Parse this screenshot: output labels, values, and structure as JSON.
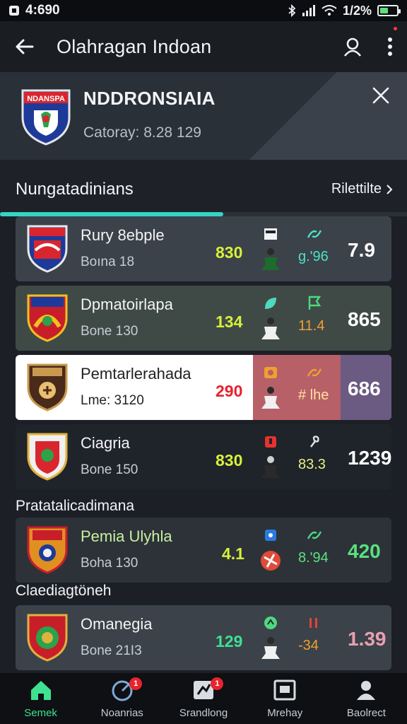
{
  "status_bar": {
    "time": "4:690",
    "battery": "1/2%",
    "battery_level": 0.5
  },
  "header": {
    "title": "Olahragan Indoan"
  },
  "team": {
    "name": "NDDRONSIAIA",
    "category": "Catoray: 8.28 129",
    "crest_text": "NDANSPA"
  },
  "section": {
    "title": "Nungatadinians",
    "more_label": "Rilettilte"
  },
  "cards": [
    {
      "name": "Rury 8ebple",
      "sub": "Boına 18",
      "score": "830",
      "stat": "g.'96",
      "rating": "7.9",
      "score_color": "#d8f03a",
      "stat_color": "#4fe0c8",
      "small_icon": "card-icon",
      "stat_icon": "link-icon"
    },
    {
      "name": "Dpmatoirlapa",
      "sub": "Bone 130",
      "score": "134",
      "stat": "11.4",
      "rating": "865",
      "score_color": "#d8f03a",
      "stat_color": "#f0a030",
      "small_icon": "leaf-icon",
      "stat_icon": "flag-icon"
    },
    {
      "name": "Pemtarlerahada",
      "sub": "Lme: 3120",
      "score": "290",
      "stat": "# lhe",
      "rating": "686",
      "score_color": "#e8222e",
      "stat_color": "#ffe2a0",
      "small_icon": "badge-icon",
      "stat_icon": "link-icon"
    },
    {
      "name": "Ciagria",
      "sub": "Bone 150",
      "score": "830",
      "stat": "83.3",
      "rating": "1239",
      "score_color": "#d8f03a",
      "stat_color": "#e8f080",
      "small_icon": "card-icon",
      "stat_icon": "pin-icon"
    }
  ],
  "group2": {
    "label": "Pratatalicadimana"
  },
  "card5": {
    "name": "Pemia Ulyhla",
    "sub": "Boha 130",
    "score": "4.1",
    "stat": "8.'94",
    "rating": "420",
    "score_color": "#d8f03a",
    "stat_color": "#5ae080",
    "rating_color": "#5ae080"
  },
  "group3": {
    "label": "Claediagtöneh"
  },
  "card6": {
    "name": "Omanegia",
    "sub": "Bone 21I3",
    "score": "129",
    "stat": "-34",
    "rating": "1.39",
    "score_color": "#3fe090",
    "stat_color": "#f0a030",
    "rating_color": "#e8a0b0"
  },
  "nav": [
    {
      "label": "Semek",
      "icon": "home-icon",
      "active": true
    },
    {
      "label": "Noanrias",
      "icon": "scores-icon",
      "badge": "1"
    },
    {
      "label": "Srandlong",
      "icon": "standings-icon",
      "badge": "1"
    },
    {
      "label": "Mrehay",
      "icon": "media-icon"
    },
    {
      "label": "Baolrect",
      "icon": "profile-icon"
    }
  ]
}
